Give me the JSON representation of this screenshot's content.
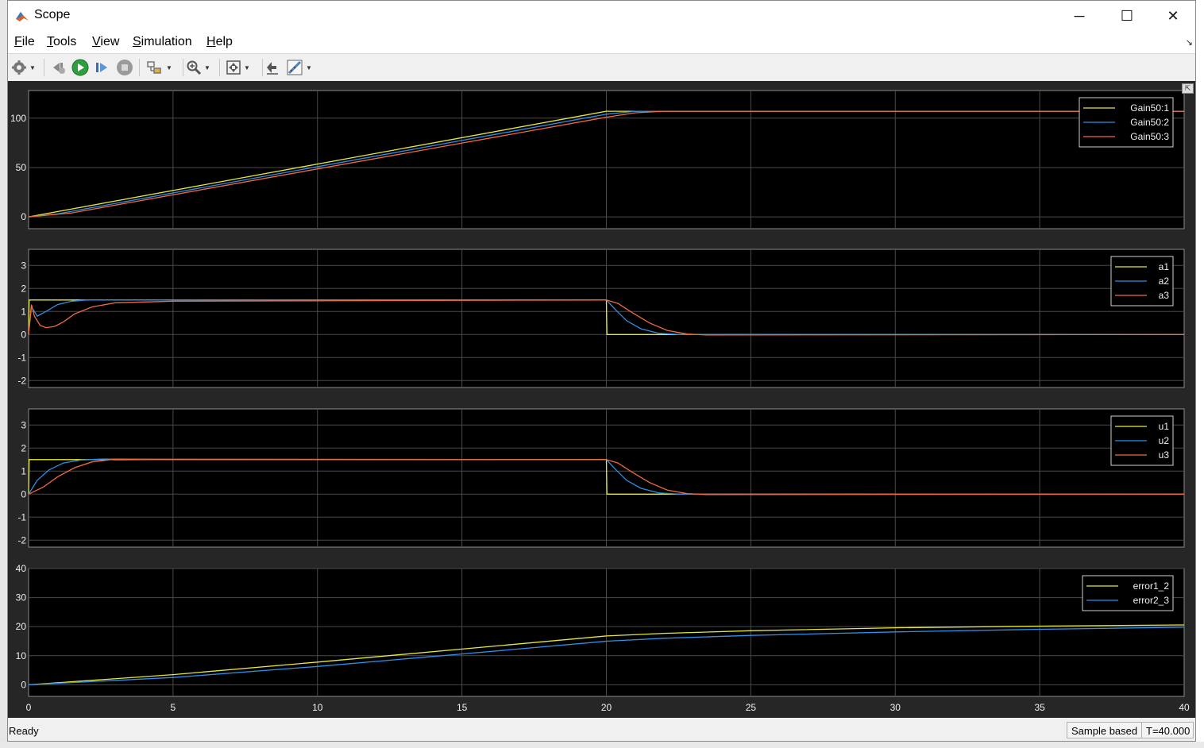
{
  "window": {
    "title": "Scope",
    "minimize_symbol": "─",
    "maximize_symbol": "☐",
    "close_symbol": "✕"
  },
  "menu": {
    "items": [
      {
        "label": "File",
        "accel": "F",
        "rest": "ile"
      },
      {
        "label": "Tools",
        "accel": "T",
        "rest": "ools"
      },
      {
        "label": "View",
        "accel": "V",
        "rest": "iew"
      },
      {
        "label": "Simulation",
        "accel": "S",
        "rest": "imulation"
      },
      {
        "label": "Help",
        "accel": "H",
        "rest": "elp"
      }
    ]
  },
  "toolbar": {
    "icons": [
      "gear-icon",
      "step-back-icon",
      "run-icon",
      "step-forward-icon",
      "stop-icon",
      "highlight-block-icon",
      "zoom-icon",
      "autoscale-icon",
      "signal-select-icon",
      "measurements-icon"
    ]
  },
  "status": {
    "ready": "Ready",
    "mode": "Sample based",
    "time": "T=40.000"
  },
  "colors": {
    "yellow": "#e8e83a",
    "blue": "#2f8fe6",
    "red": "#f26a3c",
    "green": "#44cc66",
    "axes_bg": "#000000",
    "figure_bg": "#262626",
    "grid": "#4a4a4a"
  },
  "chart_data": [
    {
      "type": "line",
      "xlim": [
        0,
        40
      ],
      "ylim": [
        -12,
        128
      ],
      "yticks": [
        0,
        50,
        100
      ],
      "xticks": [
        0,
        5,
        10,
        15,
        20,
        25,
        30,
        35,
        40
      ],
      "show_xtick_labels": false,
      "grid": true,
      "legend_position": "top-right",
      "series": [
        {
          "name": "Gain50:1",
          "color": "#e8e83a",
          "x": [
            0,
            20,
            21,
            40
          ],
          "y": [
            0,
            107,
            107,
            107
          ]
        },
        {
          "name": "Gain50:2",
          "color": "#2f8fe6",
          "x": [
            0,
            1,
            20,
            21,
            40
          ],
          "y": [
            0,
            3,
            104,
            107,
            107
          ]
        },
        {
          "name": "Gain50:3",
          "color": "#f26a3c",
          "x": [
            0,
            1.5,
            20,
            21,
            22,
            40
          ],
          "y": [
            0,
            4,
            101,
            105.5,
            107,
            107
          ]
        }
      ]
    },
    {
      "type": "line",
      "xlim": [
        0,
        40
      ],
      "ylim": [
        -2.3,
        3.7
      ],
      "yticks": [
        -2,
        -1,
        0,
        1,
        2,
        3
      ],
      "xticks": [
        0,
        5,
        10,
        15,
        20,
        25,
        30,
        35,
        40
      ],
      "show_xtick_labels": false,
      "grid": true,
      "legend_position": "top-right",
      "series": [
        {
          "name": "a1",
          "color": "#e8e83a",
          "x": [
            0,
            0.02,
            20,
            20.02,
            40
          ],
          "y": [
            0,
            1.5,
            1.5,
            0,
            0
          ]
        },
        {
          "name": "a2",
          "color": "#2f8fe6",
          "x": [
            0,
            0.1,
            0.3,
            0.6,
            1.0,
            1.5,
            2.0,
            20,
            20.3,
            20.7,
            21.2,
            21.8,
            22.5,
            40
          ],
          "y": [
            0,
            1.2,
            0.8,
            1.0,
            1.3,
            1.45,
            1.5,
            1.5,
            1.1,
            0.6,
            0.25,
            0.06,
            0,
            0
          ]
        },
        {
          "name": "a3",
          "color": "#f26a3c",
          "x": [
            0,
            0.1,
            0.2,
            0.4,
            0.6,
            0.9,
            1.2,
            1.6,
            2.2,
            3.0,
            5.0,
            20,
            20.4,
            20.9,
            21.5,
            22.1,
            22.8,
            23.5,
            40
          ],
          "y": [
            0,
            1.3,
            0.8,
            0.4,
            0.3,
            0.35,
            0.55,
            0.9,
            1.2,
            1.38,
            1.45,
            1.5,
            1.35,
            0.95,
            0.5,
            0.18,
            0.02,
            -0.02,
            0
          ]
        }
      ]
    },
    {
      "type": "line",
      "xlim": [
        0,
        40
      ],
      "ylim": [
        -2.3,
        3.7
      ],
      "yticks": [
        -2,
        -1,
        0,
        1,
        2,
        3
      ],
      "xticks": [
        0,
        5,
        10,
        15,
        20,
        25,
        30,
        35,
        40
      ],
      "show_xtick_labels": false,
      "grid": true,
      "legend_position": "top-right",
      "series": [
        {
          "name": "u1",
          "color": "#e8e83a",
          "x": [
            0,
            0.02,
            20,
            20.02,
            40
          ],
          "y": [
            0,
            1.5,
            1.5,
            0,
            0
          ]
        },
        {
          "name": "u2",
          "color": "#2f8fe6",
          "x": [
            0,
            0.3,
            0.7,
            1.2,
            1.8,
            2.5,
            20,
            20.3,
            20.7,
            21.2,
            21.8,
            22.5,
            40
          ],
          "y": [
            0,
            0.6,
            1.05,
            1.35,
            1.48,
            1.52,
            1.5,
            1.1,
            0.6,
            0.25,
            0.06,
            0,
            0
          ]
        },
        {
          "name": "u3",
          "color": "#f26a3c",
          "x": [
            0,
            0.5,
            1.0,
            1.6,
            2.2,
            3.0,
            4.0,
            20,
            20.4,
            20.9,
            21.5,
            22.1,
            22.8,
            23.5,
            40
          ],
          "y": [
            0,
            0.3,
            0.75,
            1.15,
            1.4,
            1.52,
            1.5,
            1.5,
            1.35,
            0.95,
            0.5,
            0.18,
            0.02,
            -0.02,
            0
          ]
        }
      ]
    },
    {
      "type": "line",
      "xlim": [
        0,
        40
      ],
      "ylim": [
        -4,
        40
      ],
      "yticks": [
        0,
        10,
        20,
        30,
        40
      ],
      "xticks": [
        0,
        5,
        10,
        15,
        20,
        25,
        30,
        35,
        40
      ],
      "show_xtick_labels": true,
      "grid": true,
      "legend_position": "top-right",
      "series": [
        {
          "name": "error1_2",
          "color": "#e8e83a",
          "x": [
            0,
            5,
            10,
            15,
            20,
            22,
            25,
            30,
            35,
            40
          ],
          "y": [
            0,
            3.5,
            7.8,
            12.3,
            16.8,
            17.7,
            18.6,
            19.6,
            20.2,
            20.6
          ]
        },
        {
          "name": "error2_3",
          "color": "#2f8fe6",
          "x": [
            0,
            5,
            10,
            15,
            20,
            22,
            25,
            30,
            35,
            40
          ],
          "y": [
            0,
            2.5,
            6.3,
            10.6,
            15.0,
            16.0,
            17.0,
            18.2,
            19.1,
            19.8
          ]
        }
      ]
    }
  ]
}
